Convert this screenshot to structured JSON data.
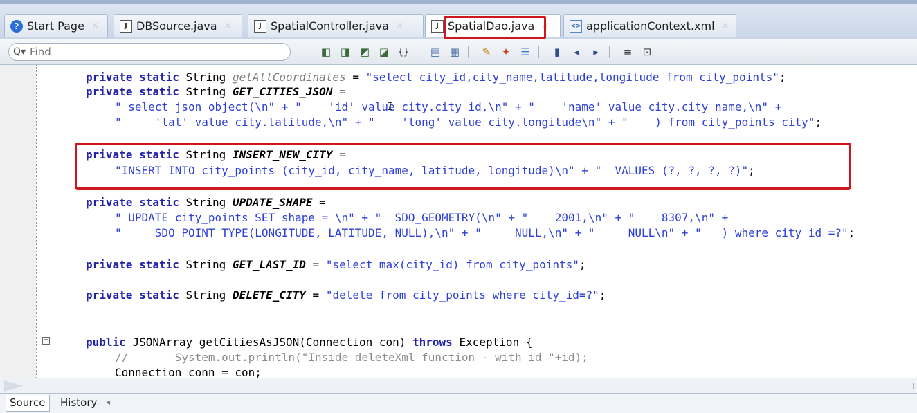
{
  "tabs": [
    {
      "label": "Start Page",
      "icon": "help-icon"
    },
    {
      "label": "DBSource.java",
      "icon": "java-file-icon"
    },
    {
      "label": "SpatialController.java",
      "icon": "java-file-icon"
    },
    {
      "label": "SpatialDao.java",
      "icon": "java-file-icon",
      "active": true
    },
    {
      "label": "applicationContext.xml",
      "icon": "xml-file-icon"
    }
  ],
  "close_glyph": "×",
  "toolbar": {
    "search_placeholder": "Find",
    "buttons": [
      "back-icon",
      "forward-icon",
      "last-edit-icon",
      "match-icon",
      "brace-icon",
      "find-prev-icon",
      "find-next-icon",
      "highlight-icon",
      "toggle-highlight-icon",
      "rectangle-select-icon",
      "bookmark-icon",
      "prev-bookmark-icon",
      "next-bookmark-icon",
      "indent-icon",
      "shift-icon"
    ]
  },
  "code": {
    "l1": {
      "k": "private static ",
      "t": "String ",
      "f": "getAllCoordinates",
      "e": " = ",
      "s": "\"select city_id,city_name,latitude,longitude from city_points\"",
      "z": ";"
    },
    "l2": {
      "k": "private static ",
      "t": "String ",
      "f": "GET_CITIES_JSON",
      "e": " ="
    },
    "l3": {
      "s": "\" select json_object(\\n\" + \"    'id' value city.city_id,\\n\" + \"    'name' value city.city_name,\\n\" +"
    },
    "l4": {
      "s": "\"     'lat' value city.latitude,\\n\" + \"    'long' value city.longitude\\n\" + \"    ) from city_points city\"",
      "z": ";"
    },
    "l5": {
      "k": "private static ",
      "t": "String ",
      "f": "INSERT_NEW_CITY",
      "e": " ="
    },
    "l6": {
      "s": "\"INSERT INTO city_points (city_id, city_name, latitude, longitude)\\n\" + \"  VALUES (?, ?, ?, ?)\"",
      "z": ";"
    },
    "l7": {
      "k": "private static ",
      "t": "String ",
      "f": "UPDATE_SHAPE",
      "e": " ="
    },
    "l8": {
      "s": "\" UPDATE city_points SET shape = \\n\" + \"  SDO_GEOMETRY(\\n\" + \"    2001,\\n\" + \"    8307,\\n\" +"
    },
    "l9": {
      "s": "\"     SDO_POINT_TYPE(LONGITUDE, LATITUDE, NULL),\\n\" + \"     NULL,\\n\" + \"     NULL\\n\" + \"   ) where city_id =?\"",
      "z": ";"
    },
    "l10": {
      "k": "private static ",
      "t": "String ",
      "f": "GET_LAST_ID",
      "e": " = ",
      "s": "\"select max(city_id) from city_points\"",
      "z": ";"
    },
    "l11": {
      "k": "private static ",
      "t": "String ",
      "f": "DELETE_CITY",
      "e": " = ",
      "s": "\"delete from city_points where city_id=?\"",
      "z": ";"
    },
    "l12": {
      "k": "public ",
      "t": "JSONArray getCitiesAsJSON(Connection con) ",
      "k2": "throws",
      "e": " Exception {"
    },
    "l13": {
      "c": "//       System.out.println(\"Inside deleteXml function - with id \"+id);"
    },
    "l14": {
      "t": "Connection conn = con;"
    }
  },
  "bottom_tabs": [
    "Source",
    "History"
  ],
  "colors": {
    "highlight": "#d0161f",
    "keyword": "#2323a8",
    "string": "#2e3fd8"
  }
}
